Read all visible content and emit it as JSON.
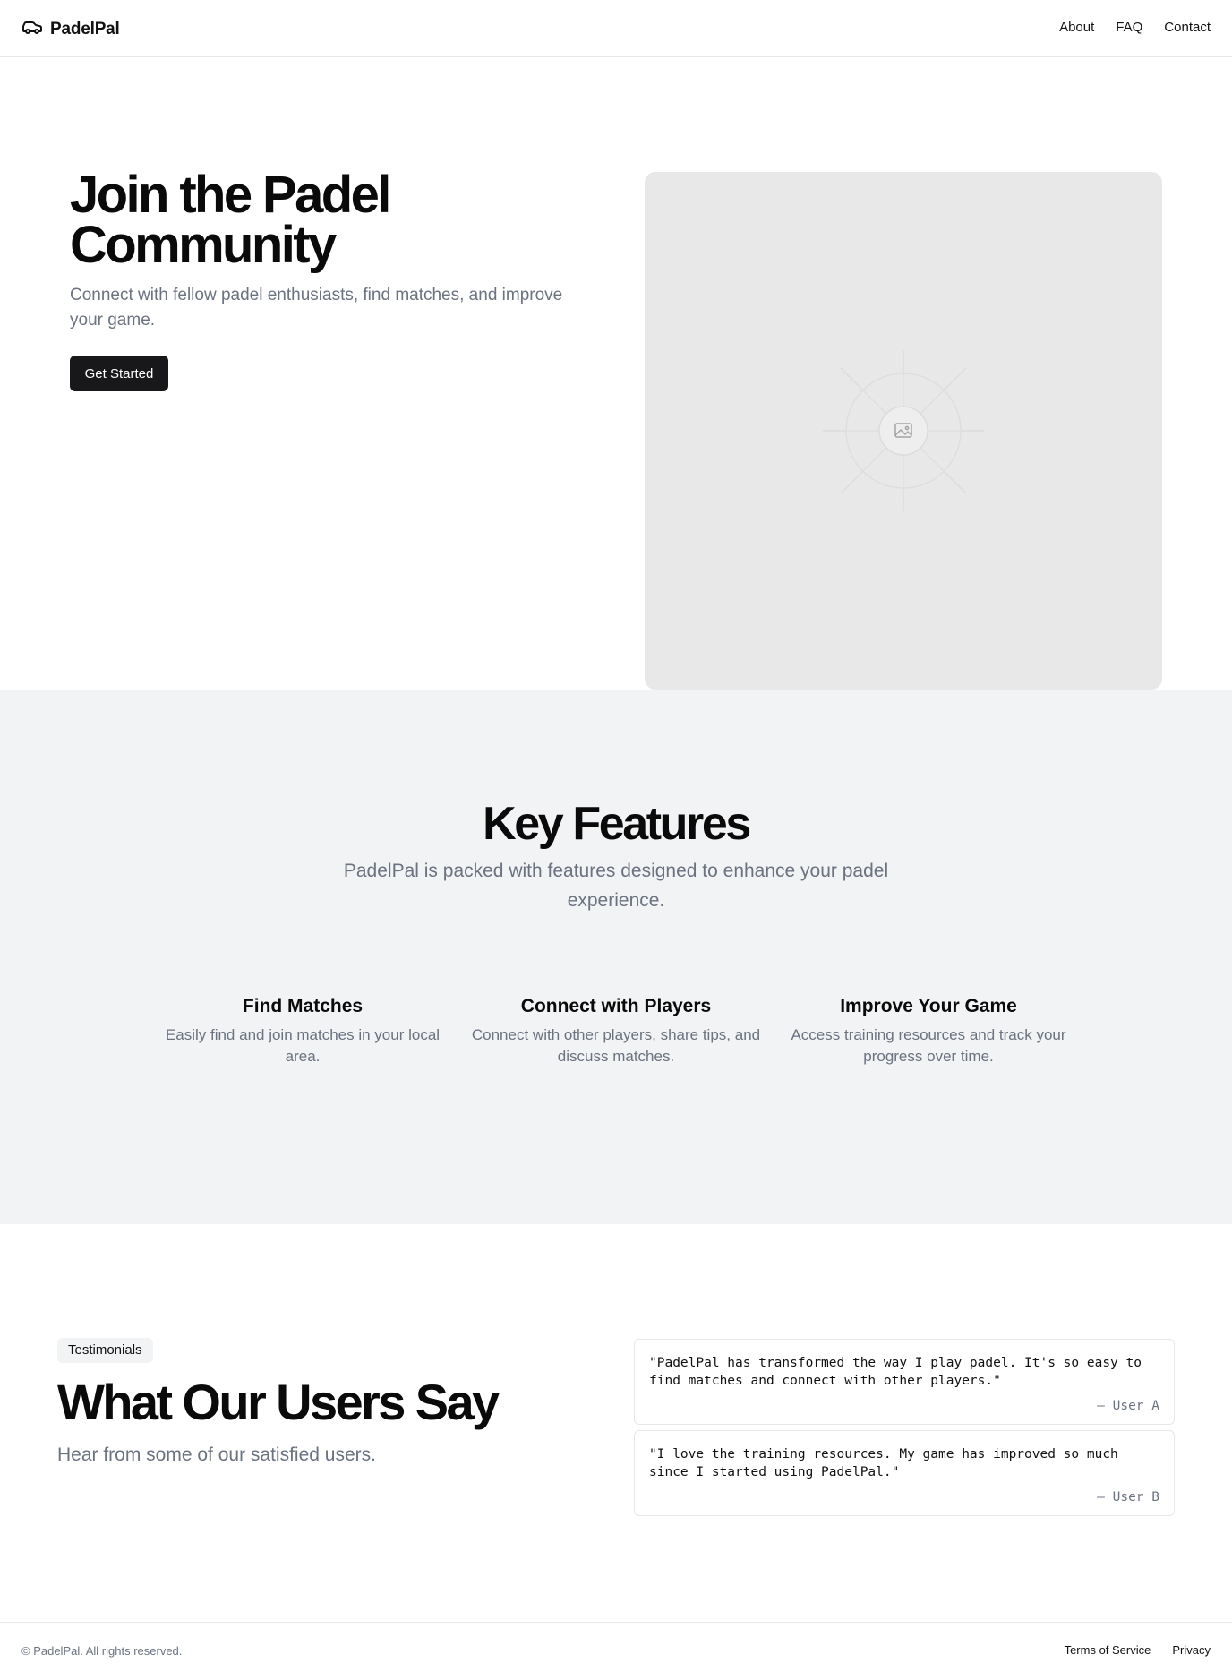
{
  "header": {
    "brand": "PadelPal",
    "brand_icon": "car-icon",
    "nav": [
      "About",
      "FAQ",
      "Contact"
    ]
  },
  "hero": {
    "title": "Join the Padel Community",
    "subtitle": "Connect with fellow padel enthusiasts, find matches, and improve your game.",
    "cta": "Get Started",
    "image_icon": "image-placeholder-icon"
  },
  "features": {
    "title": "Key Features",
    "subtitle": "PadelPal is packed with features designed to enhance your padel experience.",
    "items": [
      {
        "title": "Find Matches",
        "description": "Easily find and join matches in your local area."
      },
      {
        "title": "Connect with Players",
        "description": "Connect with other players, share tips, and discuss matches."
      },
      {
        "title": "Improve Your Game",
        "description": "Access training resources and track your progress over time."
      }
    ]
  },
  "testimonials": {
    "badge": "Testimonials",
    "title": "What Our Users Say",
    "subtitle": "Hear from some of our satisfied users.",
    "quotes": [
      {
        "text": "\"PadelPal has transformed the way I play padel. It's so easy to find matches and connect with other players.\"",
        "author": "– User A"
      },
      {
        "text": "\"I love the training resources. My game has improved so much since I started using PadelPal.\"",
        "author": "– User B"
      }
    ]
  },
  "footer": {
    "copyright": "© PadelPal. All rights reserved.",
    "links": [
      "Terms of Service",
      "Privacy"
    ]
  },
  "colors": {
    "primary_button": "#18181b",
    "muted_text": "#6b7280",
    "section_bg": "#f2f3f4",
    "placeholder_bg": "#e8e8e8"
  }
}
